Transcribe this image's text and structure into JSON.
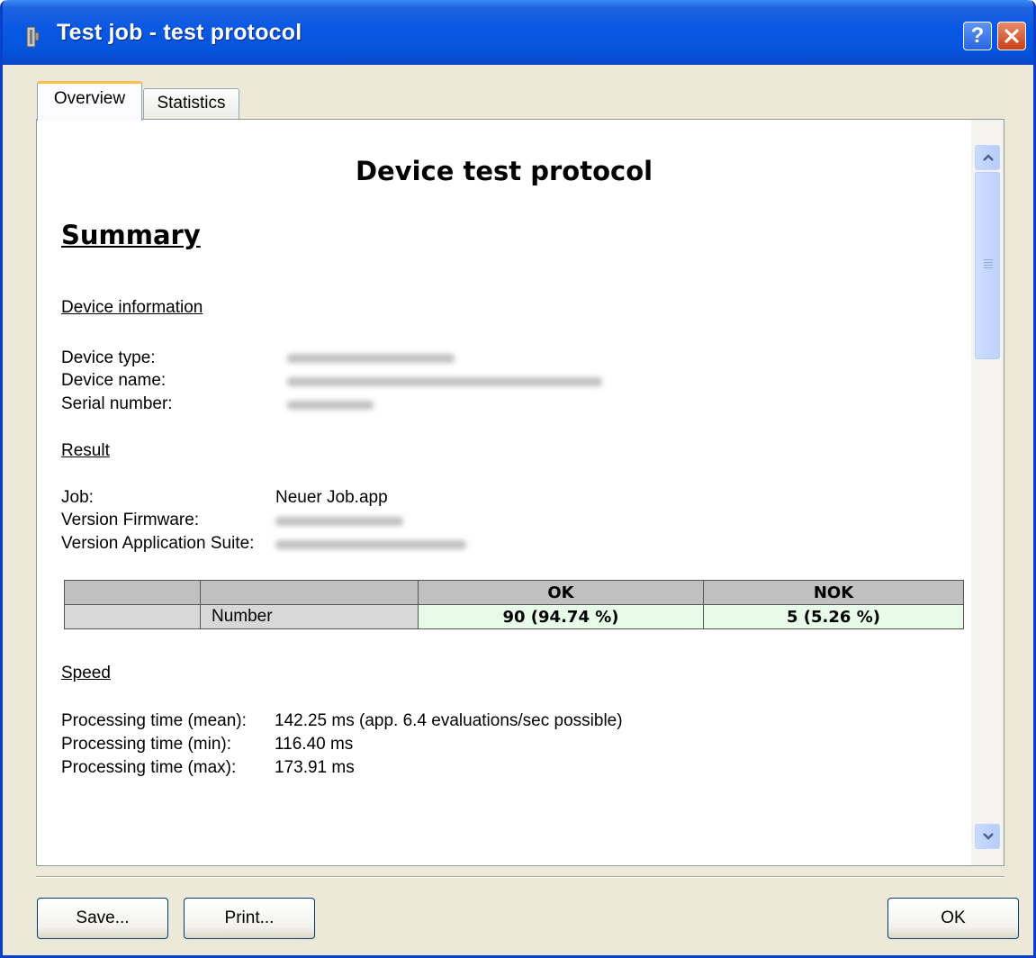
{
  "window": {
    "title": "Test job - test protocol",
    "help_label": "?"
  },
  "tabs": [
    {
      "label": "Overview",
      "selected": true
    },
    {
      "label": "Statistics",
      "selected": false
    }
  ],
  "document": {
    "title": "Device test protocol",
    "summary_heading": "Summary",
    "device_information": {
      "heading": "Device information",
      "device_type_label": "Device type:",
      "device_name_label": "Device name:",
      "serial_number_label": "Serial number:"
    },
    "result": {
      "heading": "Result",
      "job_label": "Job:",
      "job_value": "Neuer Job.app",
      "firmware_label": "Version Firmware:",
      "suite_label": "Version Application Suite:"
    },
    "table": {
      "headers": [
        "",
        "",
        "OK",
        "NOK"
      ],
      "row_label": "Number",
      "ok_value": "90 (94.74 %)",
      "nok_value": "5 (5.26 %)"
    },
    "speed": {
      "heading": "Speed",
      "mean_label": "Processing time (mean):",
      "mean_value": "142.25 ms (app. 6.4 evaluations/sec possible)",
      "min_label": "Processing time (min):",
      "min_value": "116.40 ms",
      "max_label": "Processing time (max):",
      "max_value": "173.91 ms"
    }
  },
  "buttons": {
    "save": "Save...",
    "print": "Print...",
    "ok": "OK"
  },
  "colors": {
    "titlebar": "#0858e3",
    "window_bg": "#ece9d8",
    "table_ok_bg": "#e8fbe8",
    "tab_highlight": "#f5c24b"
  }
}
